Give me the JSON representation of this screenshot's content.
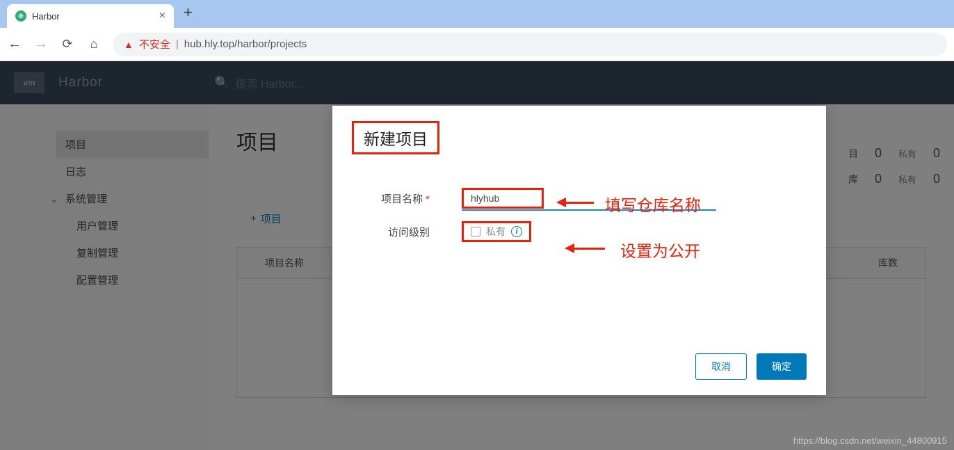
{
  "browser": {
    "tab_title": "Harbor",
    "insecure_label": "不安全",
    "url": "hub.hly.top/harbor/projects"
  },
  "header": {
    "logo": "vm",
    "brand": "Harbor",
    "search_placeholder": "搜索 Harbor..."
  },
  "sidebar": {
    "projects": "项目",
    "logs": "日志",
    "admin": "系统管理",
    "users": "用户管理",
    "replication": "复制管理",
    "config": "配置管理"
  },
  "main": {
    "title": "项目",
    "new_btn": "项目",
    "col1": "项目名称",
    "col2": "库数",
    "stats": {
      "row1_suffix": "目",
      "row1_num": "0",
      "row1_lbl": "私有",
      "row1_num2": "0",
      "row2_suffix": "库",
      "row2_num": "0",
      "row2_lbl": "私有",
      "row2_num2": "0"
    }
  },
  "modal": {
    "title": "新建项目",
    "name_label": "项目名称",
    "name_value": "hlyhub",
    "access_label": "访问级别",
    "private_label": "私有",
    "cancel": "取消",
    "ok": "确定"
  },
  "annotations": {
    "name_hint": "填写仓库名称",
    "access_hint": "设置为公开"
  },
  "watermark": "https://blog.csdn.net/weixin_44800915"
}
